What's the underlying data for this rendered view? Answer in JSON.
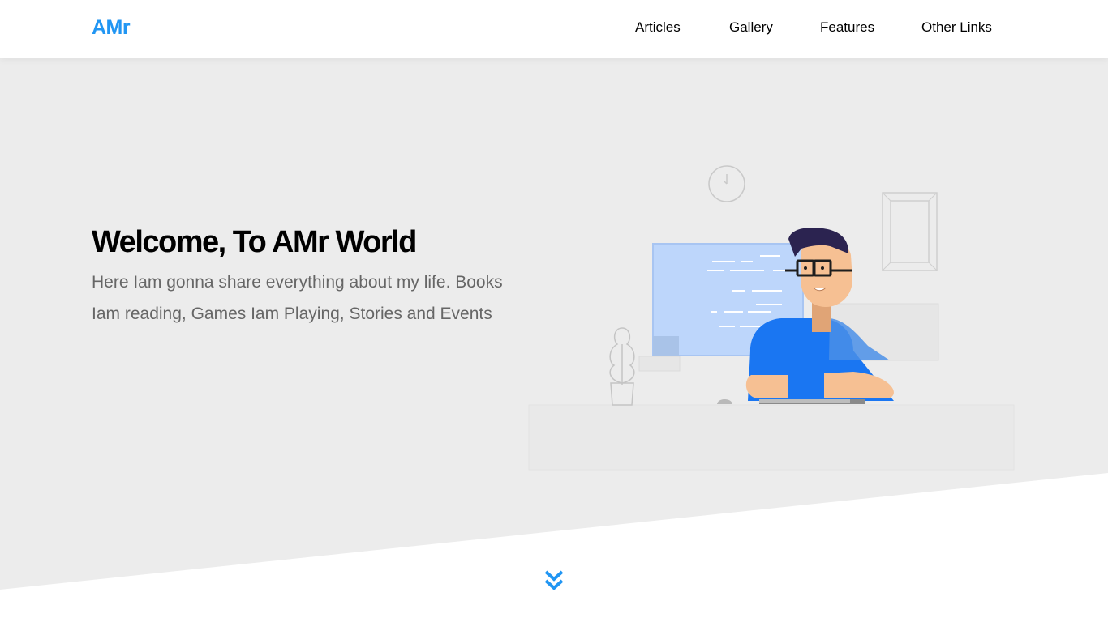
{
  "header": {
    "logo": "AMr",
    "nav": [
      {
        "label": "Articles"
      },
      {
        "label": "Gallery"
      },
      {
        "label": "Features"
      },
      {
        "label": "Other Links"
      }
    ]
  },
  "hero": {
    "title": "Welcome, To AMr World",
    "text": "Here Iam gonna share everything about my life. Books Iam reading, Games Iam Playing, Stories and Events"
  },
  "colors": {
    "accent": "#2196f3",
    "background": "#ececec",
    "shirt": "#1a76f2",
    "screen": "#bcd5fb"
  },
  "icons": {
    "scroll": "double-chevron-down-icon"
  }
}
